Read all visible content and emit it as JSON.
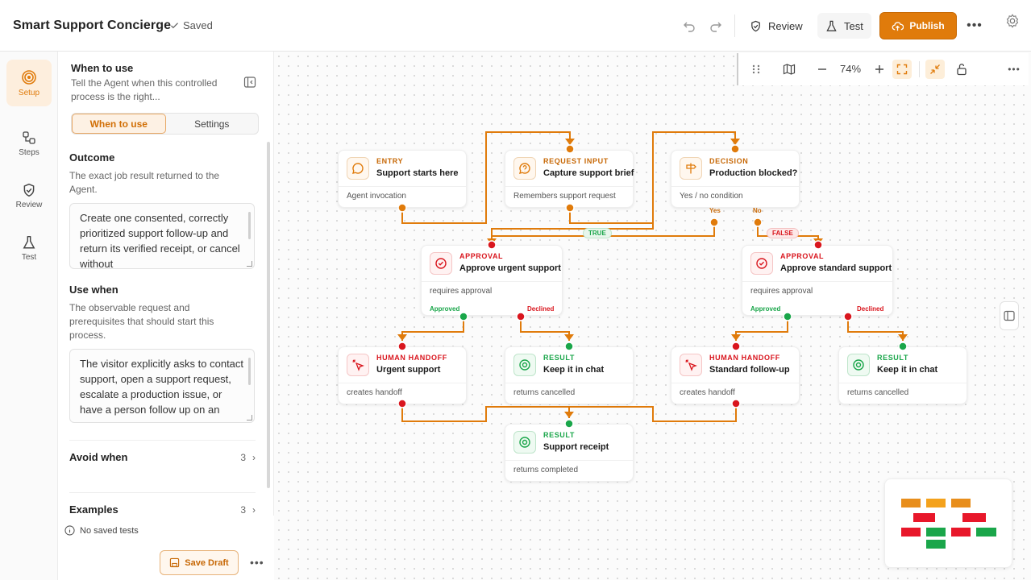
{
  "header": {
    "title": "Smart Support Concierge",
    "saved": "Saved",
    "review": "Review",
    "test": "Test",
    "publish": "Publish"
  },
  "rail": [
    {
      "label": "Setup",
      "icon": "target-icon",
      "active": true
    },
    {
      "label": "Steps",
      "icon": "steps-icon"
    },
    {
      "label": "Review",
      "icon": "shield-check-icon"
    },
    {
      "label": "Test",
      "icon": "flask-icon"
    }
  ],
  "panel": {
    "heading": "When to use",
    "subtitle": "Tell the Agent when this controlled process is the right...",
    "tabs": [
      "When to use",
      "Settings"
    ],
    "outcome": {
      "title": "Outcome",
      "desc": "The exact job result returned to the Agent.",
      "value": "Create one consented, correctly prioritized support follow-up and return its verified receipt, or cancel without"
    },
    "use_when": {
      "title": "Use when",
      "desc": "The observable request and prerequisites that should start this process.",
      "value": "The visitor explicitly asks to contact support, open a support request, escalate a production issue, or have a person follow up on an"
    },
    "avoid_when": {
      "title": "Avoid when",
      "count": "3"
    },
    "examples": {
      "title": "Examples",
      "count": "3"
    },
    "no_saved_tests": "No saved tests",
    "save_draft": "Save Draft"
  },
  "canvas": {
    "zoom": "74%",
    "edge_labels": {
      "true": "TRUE",
      "false": "FALSE"
    },
    "nodes": [
      {
        "id": "entry",
        "kind": "ENTRY",
        "title": "Support starts here",
        "footer": "Agent invocation"
      },
      {
        "id": "request",
        "kind": "REQUEST INPUT",
        "title": "Capture support brief",
        "footer": "Remembers support request"
      },
      {
        "id": "decision",
        "kind": "DECISION",
        "title": "Production blocked?",
        "footer": "Yes / no condition",
        "ports": [
          "Yes",
          "No"
        ]
      },
      {
        "id": "approval_urgent",
        "kind": "APPROVAL",
        "title": "Approve urgent support",
        "footer": "requires approval",
        "ports": [
          "Approved",
          "Declined"
        ]
      },
      {
        "id": "approval_standard",
        "kind": "APPROVAL",
        "title": "Approve standard support",
        "footer": "requires approval",
        "ports": [
          "Approved",
          "Declined"
        ]
      },
      {
        "id": "handoff_urgent",
        "kind": "HUMAN HANDOFF",
        "title": "Urgent support",
        "footer": "creates handoff"
      },
      {
        "id": "result_chat1",
        "kind": "RESULT",
        "title": "Keep it in chat",
        "footer": "returns cancelled"
      },
      {
        "id": "handoff_standard",
        "kind": "HUMAN HANDOFF",
        "title": "Standard follow-up",
        "footer": "creates handoff"
      },
      {
        "id": "result_chat2",
        "kind": "RESULT",
        "title": "Keep it in chat",
        "footer": "returns cancelled"
      },
      {
        "id": "result_receipt",
        "kind": "RESULT",
        "title": "Support receipt",
        "footer": "returns completed"
      }
    ]
  },
  "colors": {
    "accent": "#e07b0b",
    "entry": "#e07b0b",
    "approval": "#d9161e",
    "handoff": "#d9161e",
    "result": "#1aa64a",
    "wire": "#e07b0b"
  }
}
